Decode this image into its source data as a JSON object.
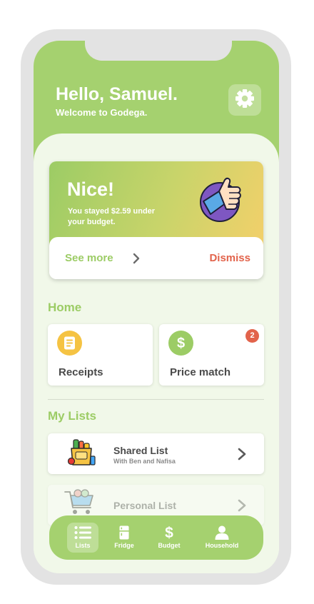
{
  "header": {
    "greeting": "Hello, Samuel.",
    "subtitle": "Welcome to Godega.",
    "settings_icon": "gear-icon"
  },
  "promo": {
    "title": "Nice!",
    "message": "You stayed $2.59 under your budget.",
    "see_more_label": "See more",
    "dismiss_label": "Dismiss",
    "illustration": "thumbs-up-icon"
  },
  "home": {
    "section_title": "Home",
    "tiles": [
      {
        "label": "Receipts",
        "icon": "receipt-icon",
        "color": "#f5c343"
      },
      {
        "label": "Price match",
        "icon": "dollar-icon",
        "color": "#9ccc65",
        "badge": "2"
      }
    ]
  },
  "lists": {
    "section_title": "My Lists",
    "items": [
      {
        "title": "Shared List",
        "subtitle": "With Ben and Nafisa",
        "icon": "grocery-bag-icon"
      },
      {
        "title": "Personal List",
        "subtitle": "",
        "icon": "shopping-cart-icon"
      }
    ]
  },
  "nav": {
    "items": [
      {
        "label": "Lists",
        "icon": "list-icon",
        "active": true
      },
      {
        "label": "Fridge",
        "icon": "fridge-icon"
      },
      {
        "label": "Budget",
        "icon": "dollar-icon"
      },
      {
        "label": "Household",
        "icon": "person-icon"
      }
    ]
  },
  "colors": {
    "primary": "#a5d16f",
    "accent_green": "#9ccc65",
    "danger": "#e2634b",
    "background": "#f1f8e9"
  }
}
